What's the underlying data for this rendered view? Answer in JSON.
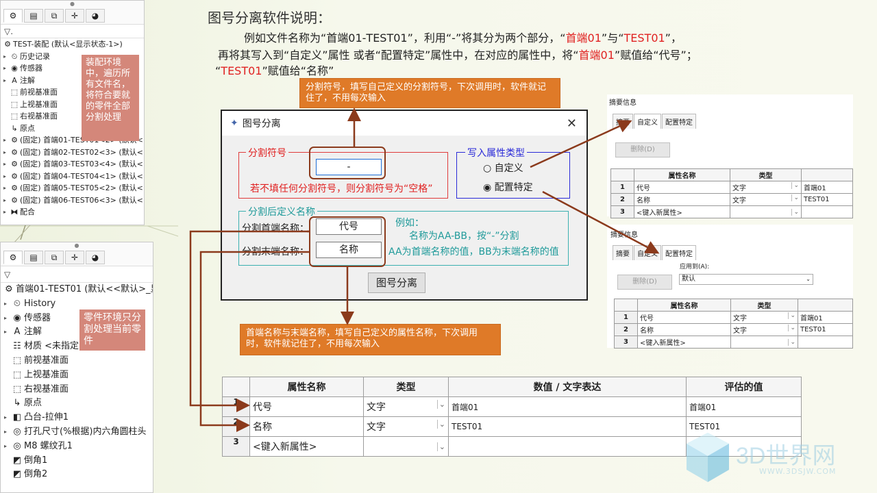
{
  "heading": {
    "title": "图号分离软件说明：",
    "line1_a": "例如文件名称为“首端01-TEST01”，利用“-”将其分为两个部分，“",
    "line1_b": "首端01",
    "line1_c": "”与“",
    "line1_d": "TEST01",
    "line1_e": "”，",
    "line2_a": "再将其写入到“自定义”属性 或者“配置特定”属性中，在对应的属性中，将“",
    "line2_b": "首端01",
    "line2_c": "”赋值给“代号”；",
    "line3_a": "“",
    "line3_b": "TEST01",
    "line3_c": "”赋值给“名称”"
  },
  "assembly_tree": {
    "root": "TEST-装配 (默认<显示状态-1>)",
    "items": [
      "历史记录",
      "传感器",
      "注解",
      "前视基准面",
      "上视基准面",
      "右视基准面",
      "原点",
      "(固定) 首端01-TEST01<2> (默认<",
      "(固定) 首端02-TEST02<3> (默认<",
      "(固定) 首端03-TEST03<4> (默认<",
      "(固定) 首端04-TEST04<1> (默认<",
      "(固定) 首端05-TEST05<2> (默认<",
      "(固定) 首端06-TEST06<3> (默认<",
      "配合"
    ],
    "note": "装配环境中，遍历所有文件名，将符合要就的零件全部分割处理"
  },
  "part_tree": {
    "root": "首端01-TEST01 (默认<<默认>_显",
    "items": [
      "History",
      "传感器",
      "注解",
      "材质 <未指定>",
      "前视基准面",
      "上视基准面",
      "右视基准面",
      "原点",
      "凸台-拉伸1",
      "打孔尺寸(%根据)内六角圆柱头",
      "M8 螺纹孔1",
      "倒角1",
      "倒角2"
    ],
    "note": "零件环境只分割处理当前零件"
  },
  "callouts": {
    "top": "分割符号，填写自己定义的分割符号，下次调用时，软件就记住了，不用每次输入",
    "bottom": "首端名称与末端名称，填写自己定义的属性名称，下次调用时，软件就记住了，不用每次输入"
  },
  "dialog": {
    "title": "图号分离",
    "sep_group": "分割符号",
    "sep_value": "-",
    "sep_hint": "若不填任何分割符号，则分割符号为“空格”",
    "write_group": "写入属性类型",
    "radio_custom": "自定义",
    "radio_config": "配置特定",
    "after_group": "分割后定义名称",
    "head_label": "分割首端名称：",
    "head_value": "代号",
    "tail_label": "分割末端名称：",
    "tail_value": "名称",
    "example1": "例如：",
    "example2": "名称为AA-BB，按“-”分割",
    "example3": "AA为首端名称的值，BB为末端名称的值",
    "run_button": "图号分离"
  },
  "custom_panel": {
    "header": "摘要信息",
    "tabs": [
      "摘要",
      "自定义",
      "配置特定"
    ],
    "delete": "删除(D)",
    "cols": [
      "属性名称",
      "类型"
    ],
    "rows": [
      {
        "n": "1",
        "name": "代号",
        "type": "文字",
        "val": "首端01"
      },
      {
        "n": "2",
        "name": "名称",
        "type": "文字",
        "val": "TEST01"
      },
      {
        "n": "3",
        "name": "<键入新属性>",
        "type": "",
        "val": ""
      }
    ]
  },
  "config_panel": {
    "header": "摘要信息",
    "tabs": [
      "摘要",
      "自定义",
      "配置特定"
    ],
    "apply_to": "应用到(A):",
    "apply_value": "默认",
    "delete": "删除(D)",
    "cols": [
      "属性名称",
      "类型"
    ],
    "rows": [
      {
        "n": "1",
        "name": "代号",
        "type": "文字",
        "val": "首端01"
      },
      {
        "n": "2",
        "name": "名称",
        "type": "文字",
        "val": "TEST01"
      },
      {
        "n": "3",
        "name": "<键入新属性>",
        "type": "",
        "val": ""
      }
    ]
  },
  "big_table": {
    "cols": [
      "属性名称",
      "类型",
      "数值 / 文字表达",
      "评估的值"
    ],
    "rows": [
      {
        "n": "1",
        "name": "代号",
        "type": "文字",
        "expr": "首端01",
        "eval": "首端01"
      },
      {
        "n": "2",
        "name": "名称",
        "type": "文字",
        "expr": "TEST01",
        "eval": "TEST01"
      },
      {
        "n": "3",
        "name": "<键入新属性>",
        "type": "",
        "expr": "",
        "eval": ""
      }
    ]
  },
  "watermark": {
    "title": "3D世界网",
    "url": "WWW.3DSJW.COM"
  },
  "colors": {
    "accent_red": "#e02020",
    "callout": "#df7a28",
    "note": "#d4877a",
    "arrow": "#8b3a1c"
  }
}
